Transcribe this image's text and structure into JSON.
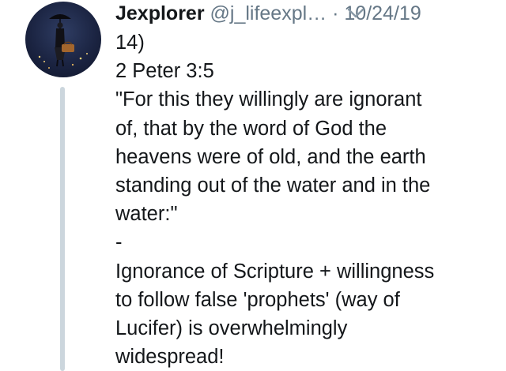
{
  "tweet": {
    "display_name": "Jexplorer",
    "handle": "@j_lifeexpl…",
    "separator": "·",
    "date": "10/24/19",
    "lines": [
      "14)",
      "2 Peter 3:5",
      "\"For this they willingly are ignorant",
      "of, that by the word of God the",
      "heavens were of old, and the earth",
      "standing out of the water and in the",
      "water:\"",
      "-",
      "Ignorance of Scripture + willingness",
      "to follow false 'prophets' (way of",
      "Lucifer) is overwhelmingly",
      "widespread!"
    ]
  },
  "icons": {
    "menu": "chevron-down-icon",
    "avatar": "user-avatar"
  },
  "colors": {
    "text": "#14171a",
    "secondary": "#657786",
    "thread_line": "#ccd6dd"
  }
}
